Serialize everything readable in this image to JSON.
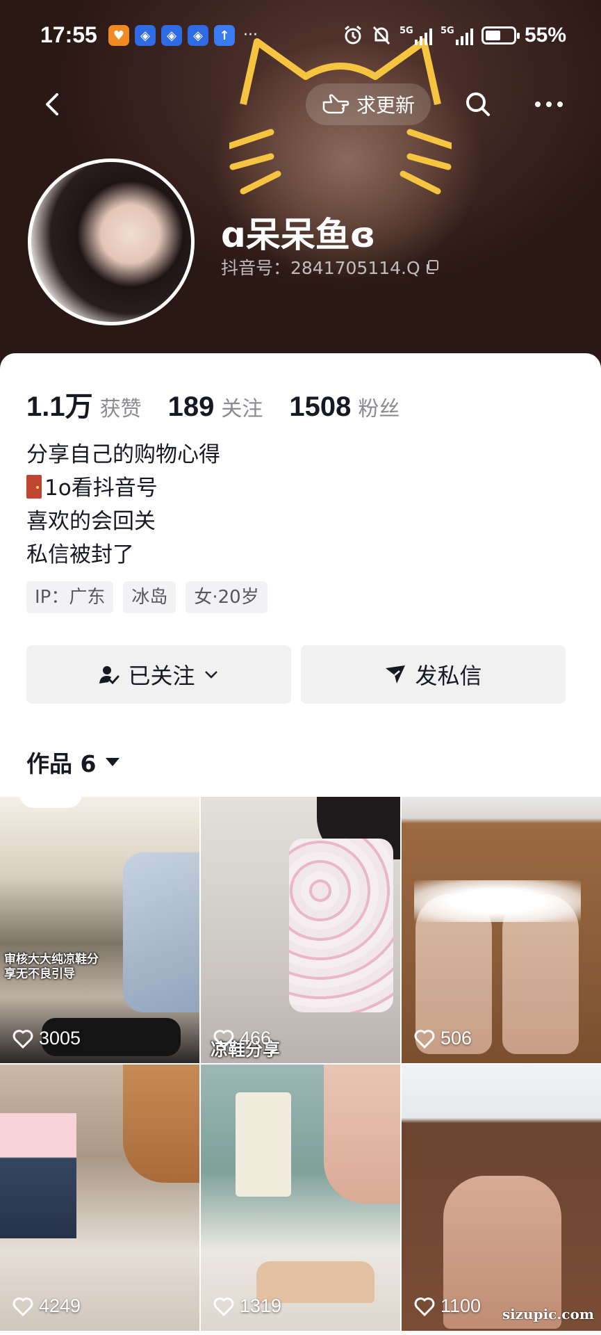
{
  "status_bar": {
    "time": "17:55",
    "battery": "55%",
    "battery_level": 0.55,
    "signal_1": "5G",
    "signal_2": "5G",
    "notif_more": "···"
  },
  "header": {
    "update_label": "求更新",
    "nickname": "ɑ呆呆鱼ɞ",
    "douyin_id": "抖音号：2841705114.Q"
  },
  "stats": [
    {
      "value": "1.1万",
      "label": "获赞"
    },
    {
      "value": "189",
      "label": "关注"
    },
    {
      "value": "1508",
      "label": "粉丝"
    }
  ],
  "bio": {
    "line1": "分享自己的购物心得",
    "line2": "1o看抖音号",
    "line3": "喜欢的会回关",
    "line4": "私信被封了"
  },
  "tags": [
    "IP：广东",
    "冰岛",
    "女·20岁"
  ],
  "actions": {
    "follow_label": "已关注",
    "message_label": "发私信"
  },
  "works": {
    "tab_label": "作品 6"
  },
  "videos": [
    {
      "likes": "3005",
      "overlay": "审核大大纯凉鞋分\n享无不良引导"
    },
    {
      "likes": "466",
      "overlay": "凉鞋分享"
    },
    {
      "likes": "506"
    },
    {
      "likes": "4249"
    },
    {
      "likes": "1319"
    },
    {
      "likes": "1100"
    }
  ],
  "watermark": "sizupic.com",
  "colors": {
    "header_bg": "#3c2420",
    "text_primary": "#161823",
    "text_secondary": "#8a8b91",
    "button_bg": "#f1f1f2"
  }
}
